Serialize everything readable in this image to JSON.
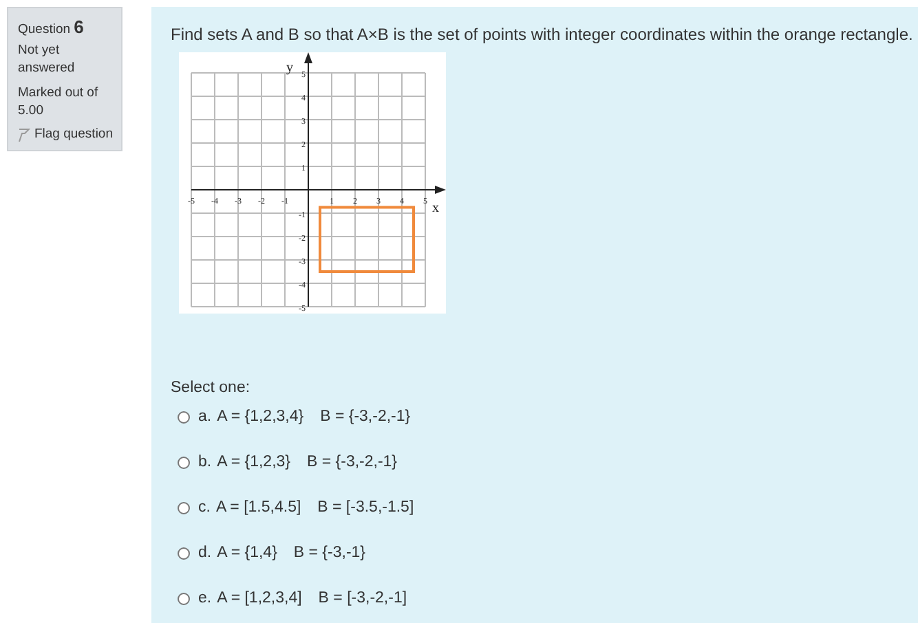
{
  "info": {
    "question_label": "Question",
    "question_number": "6",
    "state": "Not yet answered",
    "marks": "Marked out of 5.00",
    "flag": "Flag question",
    "flagged": false
  },
  "question": {
    "text": "Find sets A and B so that A×B  is the set of points with integer coordinates within the orange rectangle.",
    "graph": {
      "x_axis_label": "x",
      "y_axis_label": "y",
      "x_ticks": [
        "-5",
        "-4",
        "-3",
        "-2",
        "-1",
        "1",
        "2",
        "3",
        "4",
        "5"
      ],
      "y_ticks": [
        "5",
        "4",
        "3",
        "2",
        "1",
        "-1",
        "-2",
        "-3",
        "-4",
        "-5"
      ]
    }
  },
  "prompt": "Select one:",
  "options": [
    {
      "letter": "a.",
      "set_a": "A =  {1,2,3,4}",
      "set_b": "B = {-3,-2,-1}",
      "selected": false
    },
    {
      "letter": "b.",
      "set_a": "A =  {1,2,3}",
      "set_b": "B = {-3,-2,-1}",
      "selected": false
    },
    {
      "letter": "c.",
      "set_a": "A =  [1.5,4.5]",
      "set_b": "B = [-3.5,-1.5]",
      "selected": false
    },
    {
      "letter": "d.",
      "set_a": "A =  {1,4}",
      "set_b": "B = {-3,-1}",
      "selected": false
    },
    {
      "letter": "e.",
      "set_a": "A =  [1,2,3,4]",
      "set_b": "B = [-3,-2,-1]",
      "selected": false
    }
  ]
}
